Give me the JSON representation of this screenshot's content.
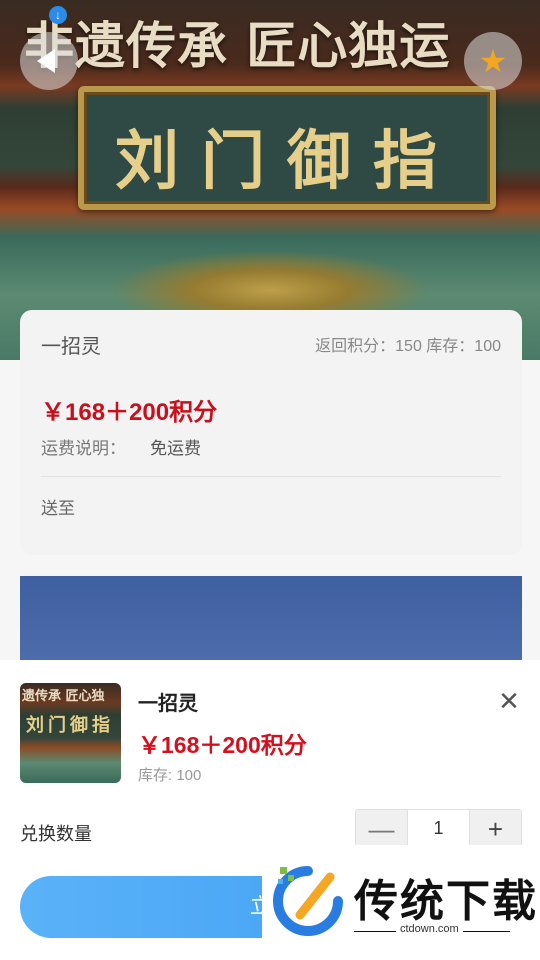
{
  "hero": {
    "title": "非遗传承 匠心独运",
    "plaque": "刘门御指"
  },
  "card": {
    "name": "一招灵",
    "meta": "返回积分：150 库存：100",
    "price": "￥168＋200积分",
    "shipping_label": "运费说明：",
    "shipping_value": "免运费",
    "send_to": "送至"
  },
  "sheet": {
    "thumb_line1": "遗传承 匠心独",
    "thumb_line2": "刘门御指",
    "name": "一招灵",
    "price": "￥168＋200积分",
    "stock": "库存: 100",
    "quantity_label": "兑换数量",
    "quantity_value": "1",
    "minus": "—",
    "plus": "+",
    "confirm_label": "立即"
  },
  "watermark": {
    "text": "传统下载",
    "url": "ctdown.com"
  },
  "colors": {
    "price_red": "#d4101f",
    "confirm_blue": "#3d9cf4",
    "star": "#f2a623"
  },
  "icons": [
    "back-icon",
    "star-icon",
    "download-icon",
    "close-icon",
    "minus-icon",
    "plus-icon"
  ]
}
